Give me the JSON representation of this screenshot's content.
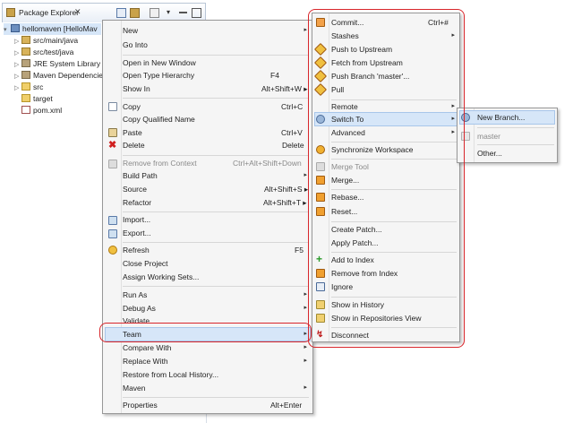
{
  "view": {
    "tab_title": "Package Explorer",
    "tab_close": "✕",
    "tree": [
      {
        "label": "hellomaven  [HelloMav",
        "twisty": "▾",
        "icon": "project-icon"
      },
      {
        "label": "src/main/java",
        "twisty": "▷",
        "icon": "package-folder-icon"
      },
      {
        "label": "src/test/java",
        "twisty": "▷",
        "icon": "package-folder-icon"
      },
      {
        "label": "JRE System Library [",
        "twisty": "▷",
        "icon": "library-icon"
      },
      {
        "label": "Maven Dependencie",
        "twisty": "▷",
        "icon": "library-icon"
      },
      {
        "label": "src",
        "twisty": "▷",
        "icon": "folder-icon"
      },
      {
        "label": "target",
        "twisty": "",
        "icon": "folder-icon"
      },
      {
        "label": "pom.xml",
        "twisty": "",
        "icon": "xml-file-icon"
      }
    ]
  },
  "context_menu": {
    "items": {
      "new": "New",
      "go_into": "Go Into",
      "open_new_window": "Open in New Window",
      "open_type_hierarchy": "Open Type Hierarchy",
      "open_type_hierarchy_sc": "F4",
      "show_in": "Show In",
      "show_in_sc": "Alt+Shift+W ▸",
      "copy": "Copy",
      "copy_sc": "Ctrl+C",
      "copy_qualified": "Copy Qualified Name",
      "paste": "Paste",
      "paste_sc": "Ctrl+V",
      "delete": "Delete",
      "delete_sc": "Delete",
      "remove_context": "Remove from Context",
      "remove_context_sc": "Ctrl+Alt+Shift+Down",
      "build_path": "Build Path",
      "source": "Source",
      "source_sc": "Alt+Shift+S ▸",
      "refactor": "Refactor",
      "refactor_sc": "Alt+Shift+T ▸",
      "import": "Import...",
      "export": "Export...",
      "refresh": "Refresh",
      "refresh_sc": "F5",
      "close_project": "Close Project",
      "assign_working_sets": "Assign Working Sets...",
      "run_as": "Run As",
      "debug_as": "Debug As",
      "validate": "Validate",
      "team": "Team",
      "compare_with": "Compare With",
      "replace_with": "Replace With",
      "restore_history": "Restore from Local History...",
      "maven": "Maven",
      "properties": "Properties",
      "properties_sc": "Alt+Enter"
    }
  },
  "team_menu": {
    "commit": "Commit...",
    "commit_sc": "Ctrl+#",
    "stashes": "Stashes",
    "push_upstream": "Push to Upstream",
    "fetch_upstream": "Fetch from Upstream",
    "push_branch": "Push Branch 'master'...",
    "pull": "Pull",
    "remote": "Remote",
    "switch_to": "Switch To",
    "advanced": "Advanced",
    "synchronize": "Synchronize Workspace",
    "merge_tool": "Merge Tool",
    "merge": "Merge...",
    "rebase": "Rebase...",
    "reset": "Reset...",
    "create_patch": "Create Patch...",
    "apply_patch": "Apply Patch...",
    "add_index": "Add to Index",
    "remove_index": "Remove from Index",
    "ignore": "Ignore",
    "show_history": "Show in History",
    "show_repos": "Show in Repositories View",
    "disconnect": "Disconnect"
  },
  "switch_menu": {
    "new_branch": "New Branch...",
    "master": "master",
    "other": "Other..."
  },
  "colors": {
    "highlight_red": "#d8262b",
    "selection": "#d6e6f8"
  }
}
